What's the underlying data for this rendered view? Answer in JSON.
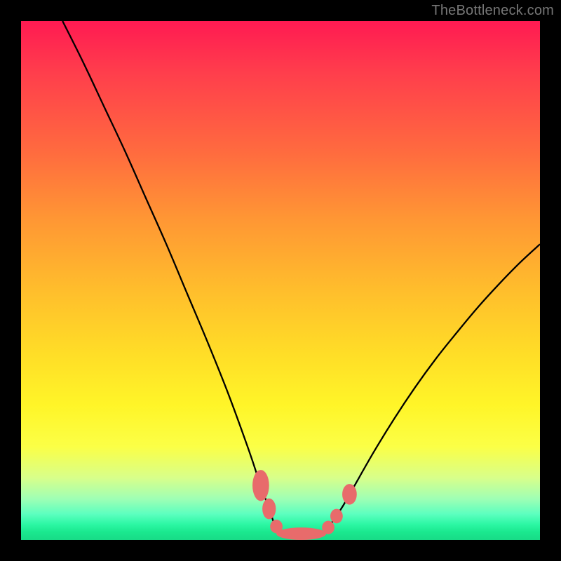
{
  "watermark": "TheBottleneck.com",
  "chart_data": {
    "type": "line",
    "title": "",
    "xlabel": "",
    "ylabel": "",
    "xlim": [
      0,
      100
    ],
    "ylim": [
      0,
      100
    ],
    "series": [
      {
        "name": "left-curve",
        "x": [
          8,
          12,
          16,
          20,
          24,
          28,
          32,
          36,
          40,
          44,
          46,
          48,
          49,
          50
        ],
        "y": [
          100,
          92,
          83.5,
          75,
          66,
          57,
          47.5,
          38,
          28,
          17,
          11,
          5.5,
          2.5,
          1.2
        ]
      },
      {
        "name": "right-curve",
        "x": [
          58,
          59,
          60,
          62,
          64,
          68,
          72,
          76,
          80,
          84,
          88,
          92,
          96,
          100
        ],
        "y": [
          1.2,
          2.2,
          3.5,
          6.5,
          10,
          17,
          23.5,
          29.5,
          35,
          40,
          44.8,
          49.2,
          53.3,
          57
        ]
      },
      {
        "name": "trough-flat",
        "x": [
          50,
          52,
          54,
          56,
          58
        ],
        "y": [
          1.2,
          1.0,
          1.0,
          1.0,
          1.2
        ]
      }
    ],
    "markers": [
      {
        "name": "left-cluster-upper",
        "cx": 46.2,
        "cy": 10.5,
        "rx": 1.6,
        "ry": 3.0
      },
      {
        "name": "left-cluster-lower",
        "cx": 47.8,
        "cy": 6.0,
        "rx": 1.3,
        "ry": 2.0
      },
      {
        "name": "left-single-low",
        "cx": 49.2,
        "cy": 2.6,
        "rx": 1.2,
        "ry": 1.3
      },
      {
        "name": "trough-band",
        "cx": 54.0,
        "cy": 1.2,
        "rx": 4.8,
        "ry": 1.2
      },
      {
        "name": "right-single-low",
        "cx": 59.2,
        "cy": 2.4,
        "rx": 1.2,
        "ry": 1.3
      },
      {
        "name": "right-single-mid",
        "cx": 60.8,
        "cy": 4.6,
        "rx": 1.2,
        "ry": 1.4
      },
      {
        "name": "right-cluster-upper",
        "cx": 63.3,
        "cy": 8.8,
        "rx": 1.4,
        "ry": 2.0
      }
    ],
    "marker_color": "#e86b6b"
  }
}
